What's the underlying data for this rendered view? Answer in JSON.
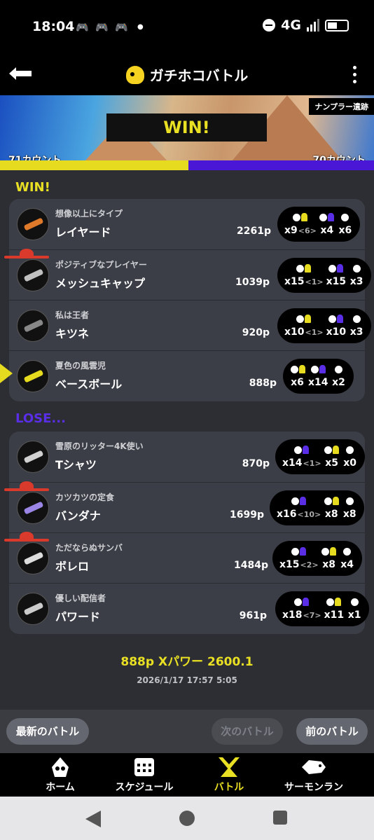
{
  "status": {
    "time": "18:04",
    "network": "4G"
  },
  "header": {
    "title": "ガチホコバトル"
  },
  "banner": {
    "stage": "ナンプラー遺跡",
    "result": "WIN!",
    "left_count": "71カウント",
    "right_count": "70カウント"
  },
  "colors": {
    "alpha": "#e6db1e",
    "bravo": "#4b17d6",
    "bg": "#2c2e33"
  },
  "win_label": "WIN!",
  "lose_label": "LOSE...",
  "win_team": [
    {
      "title": "想像以上にタイプ",
      "name": "レイヤード",
      "points": "2261p",
      "k": "x9",
      "a": "<6>",
      "sp": "x4",
      "special": "x6",
      "weapon": "#e07a2b"
    },
    {
      "title": "ポジティブなプレイヤー",
      "name": "メッシュキャップ",
      "points": "1039p",
      "k": "x15",
      "a": "<1>",
      "sp": "x15",
      "special": "x3",
      "weapon": "#c0c0c0"
    },
    {
      "title": "私は王者",
      "name": "キツネ",
      "points": "920p",
      "k": "x10",
      "a": "<1>",
      "sp": "x10",
      "special": "x3",
      "weapon": "#888"
    },
    {
      "title": "夏色の風雲児",
      "name": "ベースボール",
      "points": "888p",
      "k": "x6",
      "a": "",
      "sp": "x14",
      "special": "x2",
      "weapon": "#e6db1e"
    }
  ],
  "lose_team": [
    {
      "title": "雪原のリッター4K使い",
      "name": "Tシャツ",
      "points": "870p",
      "k": "x14",
      "a": "<1>",
      "sp": "x5",
      "special": "x0",
      "weapon": "#d0d0d0"
    },
    {
      "title": "カツカツの定食",
      "name": "バンダナ",
      "points": "1699p",
      "k": "x16",
      "a": "<10>",
      "sp": "x8",
      "special": "x8",
      "weapon": "#9b86e6"
    },
    {
      "title": "ただならぬサンバ",
      "name": "ボレロ",
      "points": "1484p",
      "k": "x15",
      "a": "<2>",
      "sp": "x8",
      "special": "x4",
      "weapon": "#ddd"
    },
    {
      "title": "優しい配信者",
      "name": "パワード",
      "points": "961p",
      "k": "x18",
      "a": "<7>",
      "sp": "x11",
      "special": "x1",
      "weapon": "#ccc"
    }
  ],
  "summary": "888p  Xパワー 2600.1",
  "date": "2026/1/17 17:57 5:05",
  "buttons": {
    "latest": "最新のバトル",
    "next": "次のバトル",
    "prev": "前のバトル"
  },
  "tabs": {
    "home": "ホーム",
    "schedule": "スケジュール",
    "battle": "バトル",
    "salmon": "サーモンラン"
  }
}
